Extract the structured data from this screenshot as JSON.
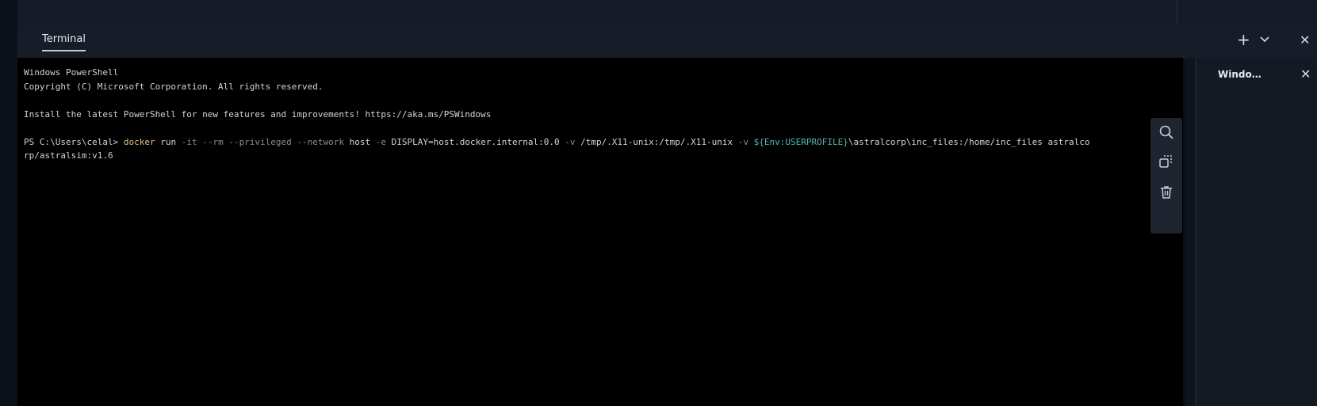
{
  "panel": {
    "tab_label": "Terminal",
    "add_icon": "plus-icon",
    "dropdown_icon": "chevron-down-icon",
    "close_icon": "close-icon"
  },
  "terminal": {
    "line1": "Windows PowerShell",
    "line2": "Copyright (C) Microsoft Corporation. All rights reserved.",
    "line3": "",
    "line4": "Install the latest PowerShell for new features and improvements! https://aka.ms/PSWindows",
    "line5": "",
    "prompt": "PS C:\\Users\\celal> ",
    "cmd_docker": "docker",
    "cmd_run": " run ",
    "cmd_flags1": "-it --rm --privileged --network",
    "cmd_host": " host ",
    "cmd_e": "-e",
    "cmd_display": " DISPLAY=host.docker.internal:0.0 ",
    "cmd_v1": "-v",
    "cmd_mount1": " /tmp/.X11-unix:/tmp/.X11-unix ",
    "cmd_v2": "-v",
    "cmd_env": " ${Env:USERPROFILE}",
    "cmd_rest1": "\\astralcorp\\inc_files:/home/inc_files astralco",
    "cmd_rest2": "rp/astralsim:v1.6",
    "tools": [
      "search-icon",
      "copy-selection-icon",
      "trash-icon"
    ]
  },
  "side": {
    "session_label": "Windo…",
    "close_icon": "close-icon"
  },
  "colors": {
    "accent": "#e5c07b",
    "cyan": "#35c5b8",
    "background": "#000000"
  }
}
